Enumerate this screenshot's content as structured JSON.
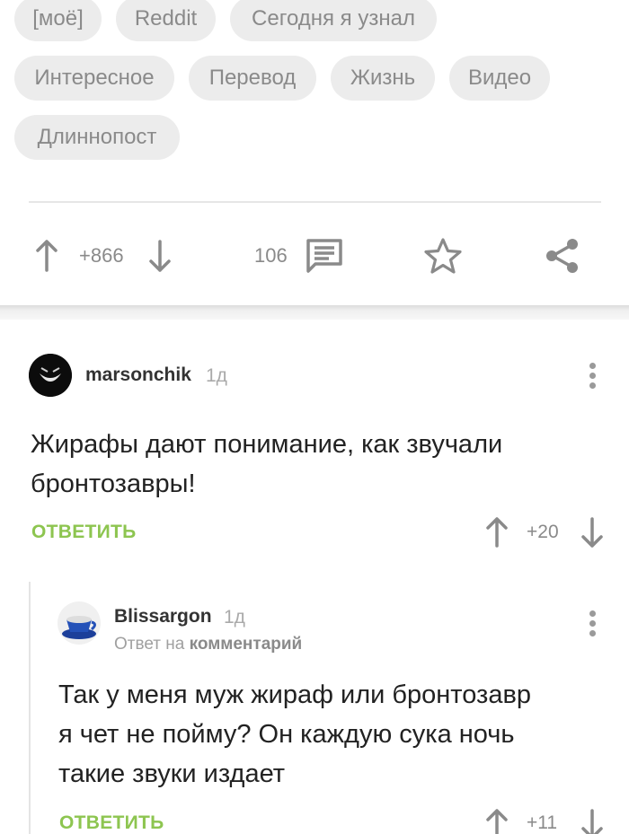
{
  "tags": [
    "[моё]",
    "Reddit",
    "Сегодня я узнал",
    "Интересное",
    "Перевод",
    "Жизнь",
    "Видео",
    "Длиннопост"
  ],
  "post_actions": {
    "rating": "+866",
    "comments_count": "106",
    "icons": [
      "arrow-up-icon",
      "arrow-down-icon",
      "comment-icon",
      "star-icon",
      "share-icon"
    ]
  },
  "comments": [
    {
      "author": "marsonchik",
      "time": "1д",
      "text_lines": [
        "Жирафы дают понимание, как звучали",
        "бронтозавры!"
      ],
      "reply_label": "ОТВЕТИТЬ",
      "rating": "+20"
    },
    {
      "author": "Blissargon",
      "time": "1д",
      "reply_prefix": "Ответ на",
      "reply_target": "комментарий",
      "text_lines": [
        "Так у меня муж жираф или бронтозавр",
        "я чет не пойму? Он каждую сука ночь",
        "такие звуки издает"
      ],
      "reply_label": "ОТВЕТИТЬ",
      "rating": "+11"
    }
  ],
  "colors": {
    "accent_green": "#8dc550",
    "tag_bg": "#ececec",
    "muted_text": "#8a8a8a"
  }
}
